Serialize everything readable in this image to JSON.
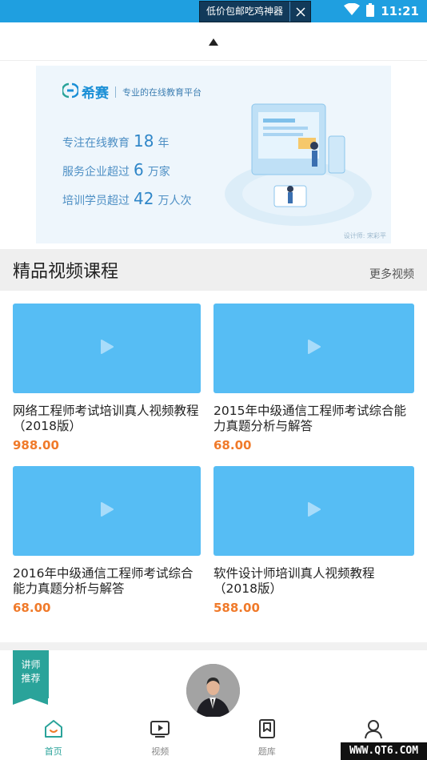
{
  "status_bar": {
    "ad_text": "低价包邮吃鸡神器",
    "time": "11:21"
  },
  "banner": {
    "brand_name": "希赛",
    "slogan": "专业的在线教育平台",
    "stats": [
      {
        "pre": "专注在线教育",
        "num": "18",
        "post": "年"
      },
      {
        "pre": "服务企业超过",
        "num": "6",
        "post": "万家"
      },
      {
        "pre": "培训学员超过",
        "num": "42",
        "post": "万人次"
      }
    ],
    "designer": "设计师: 宋彩平"
  },
  "section": {
    "title": "精品视频课程",
    "more_label": "更多视频"
  },
  "courses": [
    {
      "title": "网络工程师考试培训真人视频教程（2018版）",
      "price": "988.00"
    },
    {
      "title": "2015年中级通信工程师考试综合能力真题分析与解答",
      "price": "68.00"
    },
    {
      "title": "2016年中级通信工程师考试综合能力真题分析与解答",
      "price": "68.00"
    },
    {
      "title": "软件设计师培训真人视频教程（2018版）",
      "price": "588.00"
    }
  ],
  "teacher_tag": {
    "line1": "讲师",
    "line2": "推荐"
  },
  "tabs": [
    {
      "label": "首页",
      "icon": "home-icon",
      "active": true
    },
    {
      "label": "视频",
      "icon": "video-icon",
      "active": false
    },
    {
      "label": "题库",
      "icon": "bookmark-icon",
      "active": false
    },
    {
      "label": "",
      "icon": "user-icon",
      "active": false
    }
  ],
  "watermark": "WWW.QT6.COM",
  "colors": {
    "accent": "#2aa39a",
    "price": "#f07a2a",
    "thumb": "#56bdf4",
    "status_bar": "#1f9fe0"
  }
}
